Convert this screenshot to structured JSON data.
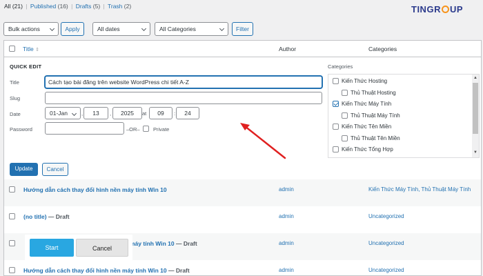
{
  "subsubsub": {
    "all": "All",
    "all_count": "(21)",
    "published": "Published",
    "published_count": "(16)",
    "drafts": "Drafts",
    "drafts_count": "(5)",
    "trash": "Trash",
    "trash_count": "(2)",
    "sep": "|"
  },
  "logo": {
    "left": "TIN",
    "right": "GR",
    "end": "UP"
  },
  "filters": {
    "bulk_actions": "Bulk actions",
    "apply": "Apply",
    "dates": "All dates",
    "categories": "All Categories",
    "filter": "Filter"
  },
  "table_header": {
    "title": "Title",
    "author": "Author",
    "categories": "Categories"
  },
  "quick_edit": {
    "heading": "QUICK EDIT",
    "title_label": "Title",
    "title_value": "Cách tạo bài đăng trên website WordPress chi tiết A-Z",
    "slug_label": "Slug",
    "slug_value": "",
    "date_label": "Date",
    "date_month": "01-Jan",
    "date_day": "13",
    "date_year": "2025",
    "date_at": "at",
    "date_hour": "09",
    "date_min": "24",
    "date_sep": ",",
    "time_sep": ":",
    "password_label": "Password",
    "password_value": "",
    "or_text": "–OR–",
    "private_label": "Private",
    "categories_label": "Categories",
    "categories": [
      {
        "label": "Kiến Thức Hosting",
        "checked": false,
        "indent": false
      },
      {
        "label": "Thủ Thuật Hosting",
        "checked": false,
        "indent": true
      },
      {
        "label": "Kiến Thức Máy Tính",
        "checked": true,
        "indent": false
      },
      {
        "label": "Thủ Thuật Máy Tính",
        "checked": false,
        "indent": true
      },
      {
        "label": "Kiến Thức Tên Miền",
        "checked": false,
        "indent": false
      },
      {
        "label": "Thủ Thuật Tên Miền",
        "checked": false,
        "indent": true
      },
      {
        "label": "Kiến Thức Tổng Hợp",
        "checked": false,
        "indent": false
      }
    ],
    "update": "Update",
    "cancel": "Cancel"
  },
  "rows": [
    {
      "title": "Hướng dẫn cách thay đổi hình nền máy tính Win 10",
      "state": "",
      "author": "admin",
      "categories": "Kiến Thức Máy Tính, Thủ Thuật Máy Tính"
    },
    {
      "title": "(no title)",
      "state": "— Draft",
      "author": "admin",
      "categories": "Uncategorized"
    },
    {
      "title": "máy tính Win 10",
      "state": "— Draft",
      "author": "admin",
      "categories": "Uncategorized"
    },
    {
      "title": "Hướng dẫn cách thay đổi hình nền máy tính Win 10",
      "state": "— Draft",
      "author": "admin",
      "categories": "Uncategorized"
    }
  ],
  "overlay": {
    "start": "Start",
    "cancel": "Cancel"
  },
  "colors": {
    "accent": "#2271b1",
    "arrow": "#e02020",
    "start": "#29a7e1",
    "logo_blue": "#2b3a8c",
    "logo_orange": "#f7941d"
  }
}
